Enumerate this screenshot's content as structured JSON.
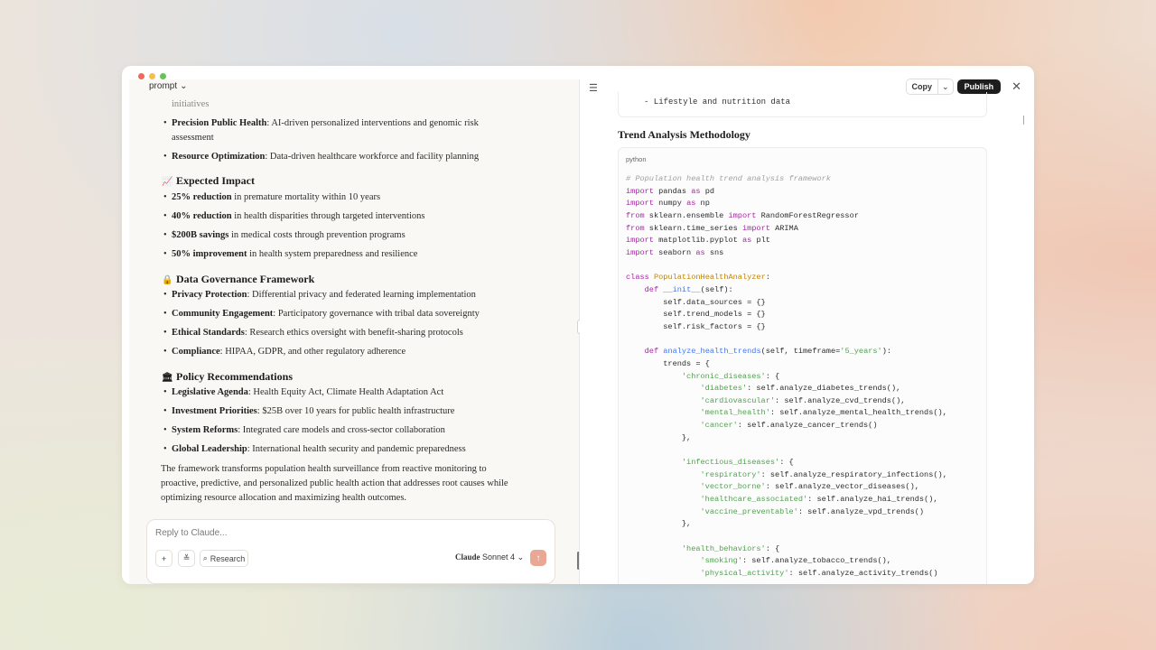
{
  "prompt_label": "prompt",
  "chat": {
    "overflow_text": "initiatives",
    "top_bullets": [
      {
        "bold": "Precision Public Health",
        "text": ": AI-driven personalized interventions and genomic risk",
        "cont": "assessment"
      },
      {
        "bold": "Resource Optimization",
        "text": ": Data-driven healthcare workforce and facility planning"
      }
    ],
    "sections": [
      {
        "emoji": "📈",
        "title": "Expected Impact",
        "bullets": [
          {
            "bold": "25% reduction",
            "text": " in premature mortality within 10 years"
          },
          {
            "bold": "40% reduction",
            "text": " in health disparities through targeted interventions"
          },
          {
            "bold": "$200B savings",
            "text": " in medical costs through prevention programs"
          },
          {
            "bold": "50% improvement",
            "text": " in health system preparedness and resilience"
          }
        ]
      },
      {
        "emoji": "🔒",
        "title": "Data Governance Framework",
        "bullets": [
          {
            "bold": "Privacy Protection",
            "text": ": Differential privacy and federated learning implementation"
          },
          {
            "bold": "Community Engagement",
            "text": ": Participatory governance with tribal data sovereignty"
          },
          {
            "bold": "Ethical Standards",
            "text": ": Research ethics oversight with benefit-sharing protocols"
          },
          {
            "bold": "Compliance",
            "text": ": HIPAA, GDPR, and other regulatory adherence"
          }
        ]
      },
      {
        "emoji": "🏛",
        "title": "Policy Recommendations",
        "bullets": [
          {
            "bold": "Legislative Agenda",
            "text": ": Health Equity Act, Climate Health Adaptation Act"
          },
          {
            "bold": "Investment Priorities",
            "text": ": $25B over 10 years for public health infrastructure"
          },
          {
            "bold": "System Reforms",
            "text": ": Integrated care models and cross-sector collaboration"
          },
          {
            "bold": "Global Leadership",
            "text": ": International health security and pandemic preparedness"
          }
        ]
      }
    ],
    "summary": [
      "The framework transforms population health surveillance from reactive monitoring to",
      "proactive, predictive, and personalized public health action that addresses root causes while",
      "optimizing resource allocation and maximizing health outcomes."
    ]
  },
  "composer": {
    "placeholder": "Reply to Claude...",
    "research_label": "Research",
    "model_brand": "Claude",
    "model_name": "Sonnet 4"
  },
  "artifact": {
    "copy_label": "Copy",
    "publish_label": "Publish",
    "prev_line": "- Lifestyle and nutrition data",
    "section_title": "Trend Analysis Methodology",
    "code_lang": "python"
  },
  "colors": {
    "accent_send": "#e8a893",
    "publish_bg": "#1d1d1d",
    "keyword": "#a626a4",
    "string": "#50a14f",
    "function": "#4078f2",
    "class": "#c18401"
  }
}
